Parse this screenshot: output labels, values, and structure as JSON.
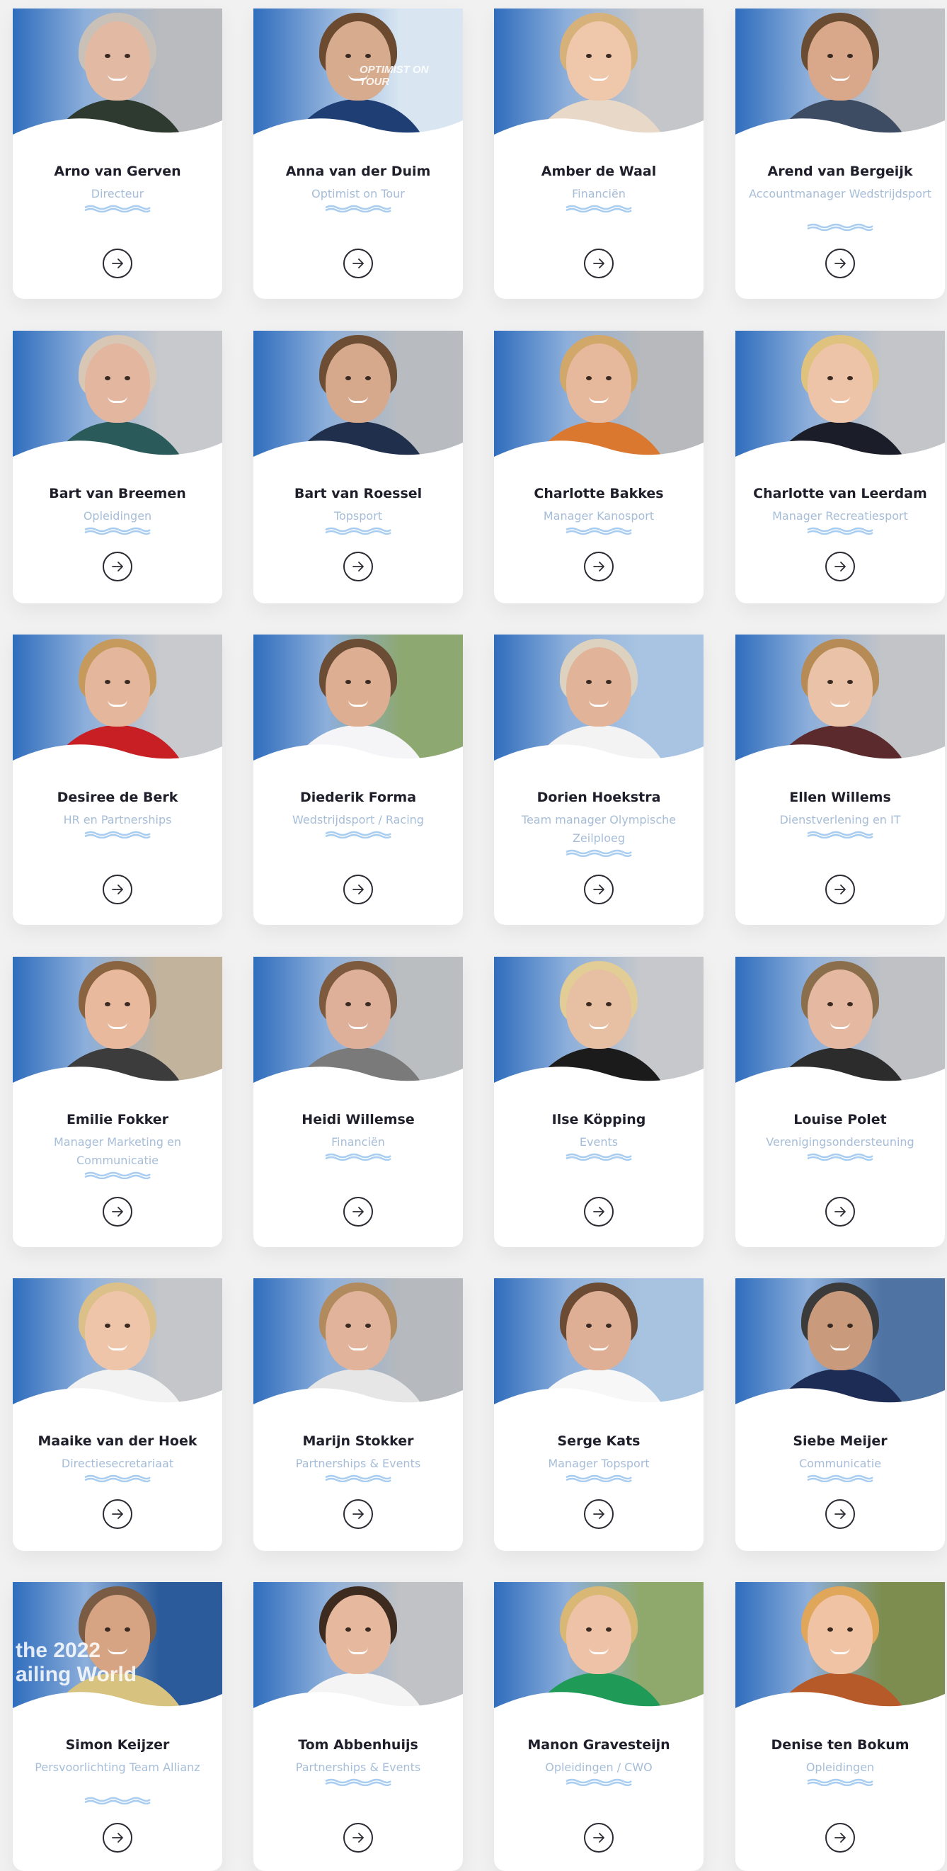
{
  "team": [
    {
      "name": "Arno van Gerven",
      "role": "Directeur",
      "link_icon": "arrow-right-icon"
    },
    {
      "name": "Anna van der Duim",
      "role": "Optimist on Tour",
      "photo_text": "OPTIMIST ON TOUR",
      "link_icon": "arrow-right-icon"
    },
    {
      "name": "Amber de Waal",
      "role": "Financiën",
      "link_icon": "arrow-right-icon"
    },
    {
      "name": "Arend van Bergeijk",
      "role": "Accountmanager Wedstrijdsport",
      "link_icon": "arrow-right-icon"
    },
    {
      "name": "Bart van Breemen",
      "role": "Opleidingen",
      "link_icon": "arrow-right-icon"
    },
    {
      "name": "Bart van Roessel",
      "role": "Topsport",
      "link_icon": "arrow-right-icon"
    },
    {
      "name": "Charlotte Bakkes",
      "role": "Manager Kanosport",
      "link_icon": "arrow-right-icon"
    },
    {
      "name": "Charlotte van Leerdam",
      "role": "Manager Recreatiesport",
      "link_icon": "arrow-right-icon"
    },
    {
      "name": "Desiree de Berk",
      "role": "HR en Partnerships",
      "link_icon": "arrow-right-icon"
    },
    {
      "name": "Diederik Forma",
      "role": "Wedstrijdsport / Racing",
      "link_icon": "arrow-right-icon"
    },
    {
      "name": "Dorien Hoekstra",
      "role": "Team manager Olympische Zeilploeg",
      "link_icon": "arrow-right-icon"
    },
    {
      "name": "Ellen Willems",
      "role": "Dienstverlening en IT",
      "link_icon": "arrow-right-icon"
    },
    {
      "name": "Emilie Fokker",
      "role": "Manager Marketing en Communicatie",
      "link_icon": "arrow-right-icon"
    },
    {
      "name": "Heidi Willemse",
      "role": "Financiën",
      "link_icon": "arrow-right-icon"
    },
    {
      "name": "Ilse Köpping",
      "role": "Events",
      "link_icon": "arrow-right-icon"
    },
    {
      "name": "Louise Polet",
      "role": "Verenigingsondersteuning",
      "link_icon": "arrow-right-icon"
    },
    {
      "name": "Maaike van der Hoek",
      "role": "Directiesecretariaat",
      "link_icon": "arrow-right-icon"
    },
    {
      "name": "Marijn Stokker",
      "role": "Partnerships & Events",
      "link_icon": "arrow-right-icon"
    },
    {
      "name": "Serge Kats",
      "role": "Manager Topsport",
      "link_icon": "arrow-right-icon"
    },
    {
      "name": "Siebe Meijer",
      "role": "Communicatie",
      "link_icon": "arrow-right-icon"
    },
    {
      "name": "Simon Keijzer",
      "role": "Persvoorlichting Team Allianz",
      "photo_text": "the 2022 ailing World",
      "link_icon": "arrow-right-icon"
    },
    {
      "name": "Tom Abbenhuijs",
      "role": "Partnerships & Events",
      "link_icon": "arrow-right-icon"
    },
    {
      "name": "Manon Gravesteijn",
      "role": "Opleidingen / CWO",
      "link_icon": "arrow-right-icon"
    },
    {
      "name": "Denise ten Bokum",
      "role": "Opleidingen",
      "link_icon": "arrow-right-icon"
    }
  ],
  "colors": {
    "brand_blue": "#2f6dbd",
    "role_text": "#a6bdd8",
    "wave_accent": "#a9cdf0",
    "name_text": "#1f1f2b",
    "page_bg": "#f1f1f2"
  }
}
